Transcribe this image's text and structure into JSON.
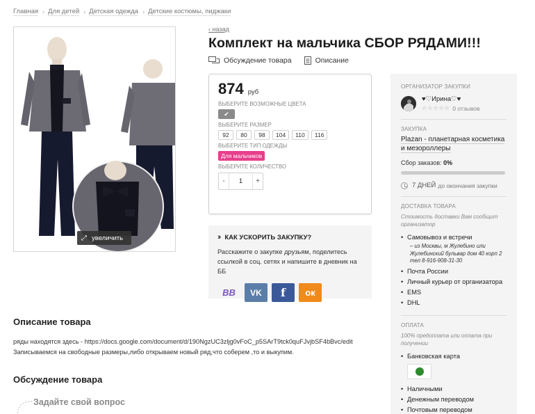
{
  "breadcrumb": [
    "Главная",
    "Для детей",
    "Детская одежда",
    "Детские костюмы, пиджаки"
  ],
  "photo": {
    "zoom_label": "увеличить"
  },
  "back_label": "‹ назад",
  "product": {
    "title": "Комплект на мальчика СБОР РЯДАМИ!!!",
    "tabs": [
      "Обсуждение товара",
      "Описание"
    ]
  },
  "buybox": {
    "price": "874",
    "currency": "руб",
    "colors_label": "ВЫБЕРИТЕ ВОЗМОЖНЫЕ ЦВЕТА",
    "color_check": "✔",
    "size_label": "ВЫБЕРИТЕ РАЗМЕР",
    "sizes": [
      "92",
      "80",
      "98",
      "104",
      "110",
      "116"
    ],
    "type_label": "ВЫБЕРИТЕ ТИП ОДЕЖДЫ",
    "type_value": "Для мальчиков",
    "qty_label": "ВЫБЕРИТЕ КОЛИЧЕСТВО",
    "qty_minus": "-",
    "qty_value": "1",
    "qty_plus": "+"
  },
  "speedup": {
    "title": "КАК УСКОРИТЬ ЗАКУПКУ?",
    "text": "Расскажите о закупке друзьям, поделитесь ссылкой в соц. сетях и напишите в дневник на ББ",
    "buttons": [
      {
        "icon": "bb-icon",
        "glyph": "BB",
        "color": "#7e57c2"
      },
      {
        "icon": "vk-icon",
        "glyph": "VK",
        "color": "#5a7ea8"
      },
      {
        "icon": "facebook-icon",
        "glyph": "f",
        "color": "#3b5998"
      },
      {
        "icon": "odnoklassniki-icon",
        "glyph": "ок",
        "color": "#f08a1a"
      }
    ]
  },
  "description": {
    "title": "Описание товара",
    "line1": "ряды находятся здесь - https://docs.google.com/document/d/190NgzUC3zljg0vFoC_p5SArT9tck0quFJvjbSF4bBvc/edit",
    "line2": "Записываемся на свободные размеры,либо открываем новый ряд,что соберем ,то и выкупим."
  },
  "discussion": {
    "title": "Обсуждение товара",
    "ask": "Задайте свой вопрос"
  },
  "sidebar": {
    "organizer_label": "ОРГАНИЗАТОР ЗАКУПКИ",
    "organizer_name": "♥♡Ирина♡♥",
    "reviews": "0 отзывов",
    "stars": "☆☆☆☆☆",
    "purchase_label": "ЗАКУПКА",
    "purchase_name": "Plazan - планетарная косметика и мезороллеры",
    "orders_label": "Сбор заказов:",
    "orders_value": "0%",
    "orders_progress": 0,
    "days_value": "7 ДНЕЙ",
    "days_text": "до окончания закупки",
    "delivery_label": "ДОСТАВКА ТОВАРА",
    "delivery_note": "Стоимость доставки Вам сообщит организатор",
    "delivery_items": [
      "Самовывоз и встречи",
      "Почта России",
      "Личный курьер от организатора",
      "EMS",
      "DHL"
    ],
    "pickup_address": "– из Москвы, м Жулебино или Жулебинский бульвар дом 40 корп 2 тел 8-916-908-31-30",
    "payment_label": "ОПЛАТА",
    "payment_note": "100% предоплата или оплата при получении",
    "payment_items": [
      "Банковская карта",
      "Наличными",
      "Денежным переводом",
      "Почтовым переводом"
    ]
  }
}
